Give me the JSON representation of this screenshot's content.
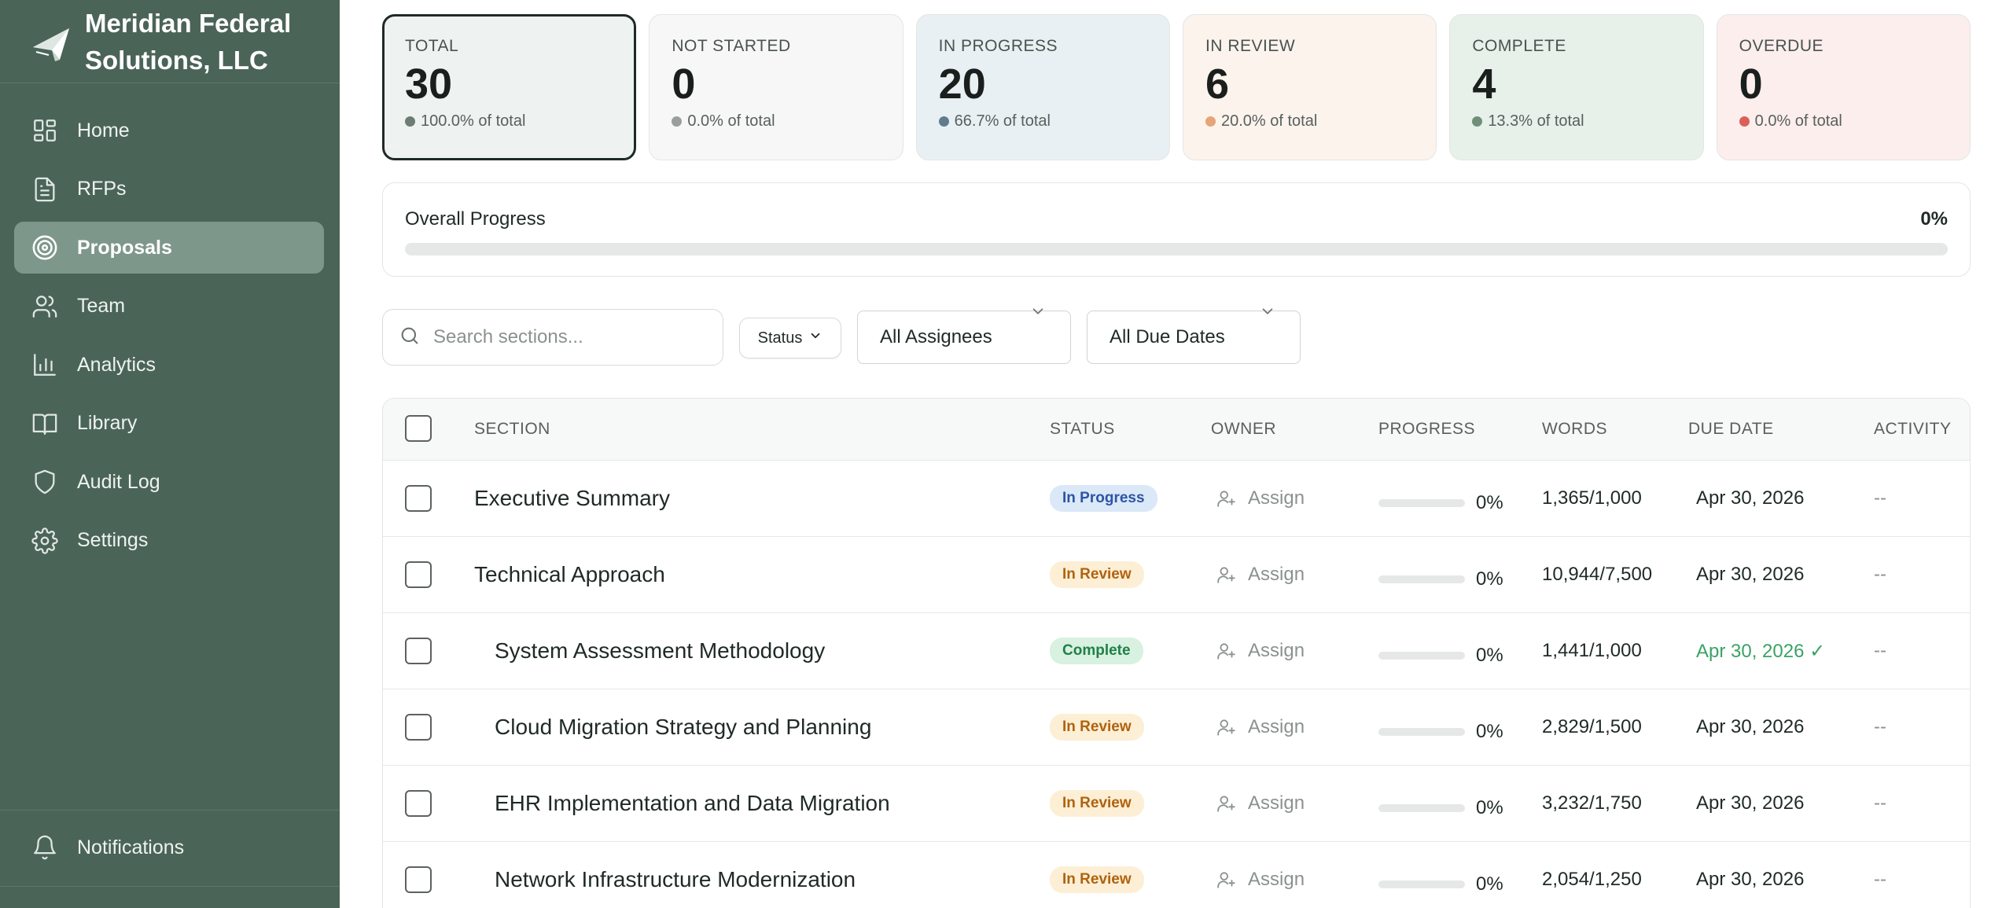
{
  "sidebar": {
    "company_name": "Meridian Federal Solutions, LLC",
    "items": [
      {
        "label": "Home",
        "icon": "grid-icon"
      },
      {
        "label": "RFPs",
        "icon": "document-icon"
      },
      {
        "label": "Proposals",
        "icon": "target-icon",
        "active": true
      },
      {
        "label": "Team",
        "icon": "users-icon"
      },
      {
        "label": "Analytics",
        "icon": "bar-chart-icon"
      },
      {
        "label": "Library",
        "icon": "book-icon"
      },
      {
        "label": "Audit Log",
        "icon": "shield-icon"
      },
      {
        "label": "Settings",
        "icon": "gear-icon"
      }
    ],
    "notifications_label": "Notifications"
  },
  "stats": [
    {
      "label": "TOTAL",
      "value": "30",
      "pct": "100.0% of total",
      "dot_color": "#6b7d74",
      "bg": "#eef2f0",
      "selected": true
    },
    {
      "label": "NOT STARTED",
      "value": "0",
      "pct": "0.0% of total",
      "dot_color": "#9a9e9c",
      "bg": "#f7f7f7"
    },
    {
      "label": "IN PROGRESS",
      "value": "20",
      "pct": "66.7% of total",
      "dot_color": "#5f7d8c",
      "bg": "#e9f0f3"
    },
    {
      "label": "IN REVIEW",
      "value": "6",
      "pct": "20.0% of total",
      "dot_color": "#e6a477",
      "bg": "#fcf3ed"
    },
    {
      "label": "COMPLETE",
      "value": "4",
      "pct": "13.3% of total",
      "dot_color": "#6f8f79",
      "bg": "#e8f0ea"
    },
    {
      "label": "OVERDUE",
      "value": "0",
      "pct": "0.0% of total",
      "dot_color": "#d9605a",
      "bg": "#fbeeed"
    }
  ],
  "overall": {
    "label": "Overall Progress",
    "value_text": "0%",
    "fraction": 0
  },
  "filters": {
    "search_placeholder": "Search sections...",
    "status_label": "Status",
    "assignees_label": "All Assignees",
    "due_label": "All Due Dates"
  },
  "table": {
    "headers": {
      "section": "SECTION",
      "status": "STATUS",
      "owner": "OWNER",
      "progress": "PROGRESS",
      "words": "WORDS",
      "due": "DUE DATE",
      "activity": "ACTIVITY"
    },
    "rows": [
      {
        "section": "Executive Summary",
        "indent": false,
        "status": "In Progress",
        "status_type": "inprogress",
        "owner": "Assign",
        "progress": 0,
        "progress_text": "0%",
        "words": "1,365/1,000",
        "due": "Apr 30, 2026",
        "due_done": false,
        "activity": "--"
      },
      {
        "section": "Technical Approach",
        "indent": false,
        "status": "In Review",
        "status_type": "inreview",
        "owner": "Assign",
        "progress": 0,
        "progress_text": "0%",
        "words": "10,944/7,500",
        "due": "Apr 30, 2026",
        "due_done": false,
        "activity": "--"
      },
      {
        "section": "System Assessment Methodology",
        "indent": true,
        "status": "Complete",
        "status_type": "complete",
        "owner": "Assign",
        "progress": 0,
        "progress_text": "0%",
        "words": "1,441/1,000",
        "due": "Apr 30, 2026 ✓",
        "due_done": true,
        "activity": "--"
      },
      {
        "section": "Cloud Migration Strategy and Planning",
        "indent": true,
        "status": "In Review",
        "status_type": "inreview",
        "owner": "Assign",
        "progress": 0,
        "progress_text": "0%",
        "words": "2,829/1,500",
        "due": "Apr 30, 2026",
        "due_done": false,
        "activity": "--"
      },
      {
        "section": "EHR Implementation and Data Migration",
        "indent": true,
        "status": "In Review",
        "status_type": "inreview",
        "owner": "Assign",
        "progress": 0,
        "progress_text": "0%",
        "words": "3,232/1,750",
        "due": "Apr 30, 2026",
        "due_done": false,
        "activity": "--"
      },
      {
        "section": "Network Infrastructure Modernization",
        "indent": true,
        "status": "In Review",
        "status_type": "inreview",
        "owner": "Assign",
        "progress": 0,
        "progress_text": "0%",
        "words": "2,054/1,250",
        "due": "Apr 30, 2026",
        "due_done": false,
        "activity": "--"
      }
    ]
  }
}
